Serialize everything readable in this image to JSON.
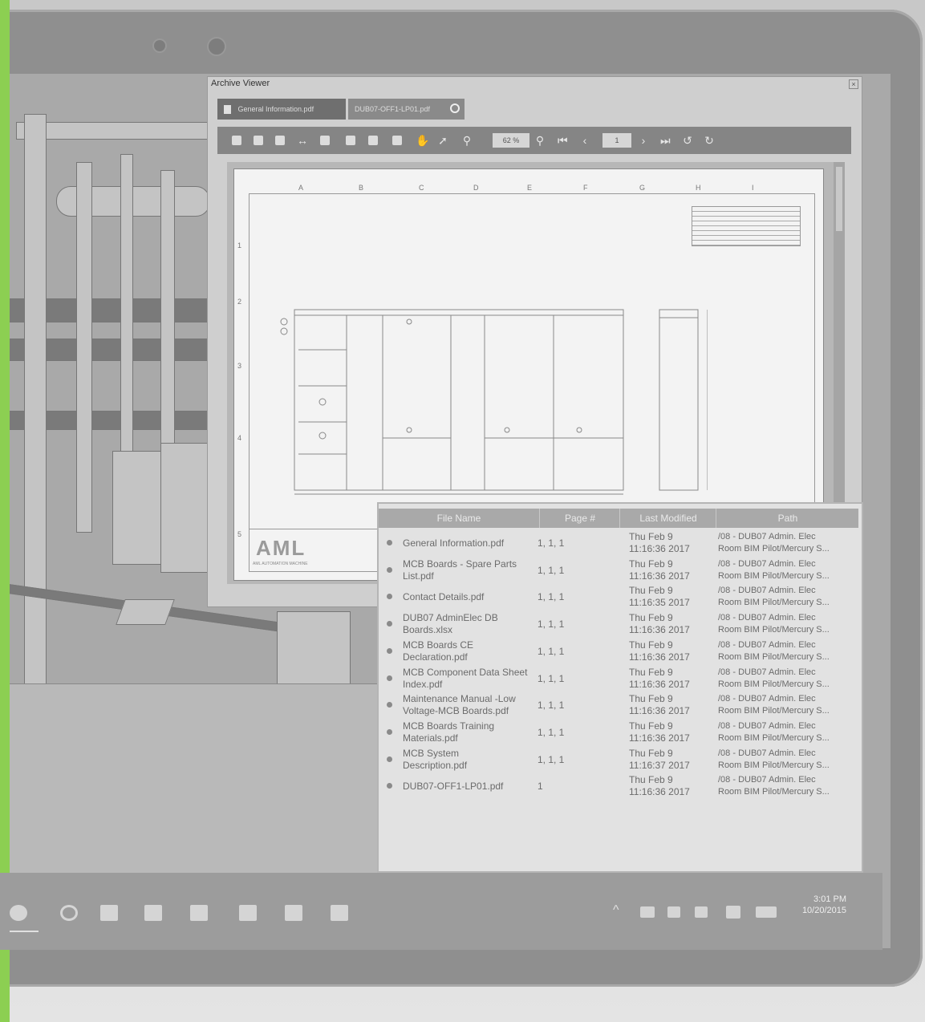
{
  "viewer": {
    "title": "Archive Viewer",
    "close_glyph": "×",
    "tabs": [
      {
        "label": "General Information.pdf",
        "icon": "pdf-doc-icon"
      },
      {
        "label": "DUB07-OFF1-LP01.pdf",
        "closable": true
      }
    ],
    "toolbar": {
      "zoom": "62 %",
      "page": "1"
    },
    "drawing": {
      "column_labels": [
        "A",
        "B",
        "C",
        "D",
        "E",
        "F",
        "G",
        "H",
        "I"
      ],
      "row_labels": [
        "1",
        "2",
        "3",
        "4",
        "5"
      ],
      "logo": "AML",
      "company": "AML AUTOMATION MACHINE"
    }
  },
  "file_list": {
    "headers": [
      "File Name",
      "Page #",
      "Last Modified",
      "Path"
    ],
    "rows": [
      {
        "name": "General Information.pdf",
        "pages": "1, 1, 1",
        "modified": [
          "Thu Feb 9",
          "11:16:36 2017"
        ],
        "path": [
          "/08 - DUB07 Admin. Elec",
          "Room BIM Pilot/Mercury S..."
        ]
      },
      {
        "name": "MCB Boards - Spare Parts List.pdf",
        "pages": "1, 1, 1",
        "modified": [
          "Thu Feb 9",
          "11:16:36 2017"
        ],
        "path": [
          "/08 - DUB07 Admin. Elec",
          "Room BIM Pilot/Mercury S..."
        ]
      },
      {
        "name": "Contact Details.pdf",
        "pages": "1, 1, 1",
        "modified": [
          "Thu Feb 9",
          "11:16:35 2017"
        ],
        "path": [
          "/08 - DUB07 Admin. Elec",
          "Room BIM Pilot/Mercury S..."
        ]
      },
      {
        "name": "DUB07 AdminElec DB Boards.xlsx",
        "pages": "1, 1, 1",
        "modified": [
          "Thu Feb 9",
          "11:16:36 2017"
        ],
        "path": [
          "/08 - DUB07 Admin. Elec",
          "Room BIM Pilot/Mercury S..."
        ]
      },
      {
        "name": "MCB Boards CE Declaration.pdf",
        "pages": "1, 1, 1",
        "modified": [
          "Thu Feb 9",
          "11:16:36 2017"
        ],
        "path": [
          "/08 - DUB07 Admin. Elec",
          "Room BIM Pilot/Mercury S..."
        ]
      },
      {
        "name": "MCB Component Data Sheet Index.pdf",
        "pages": "1, 1, 1",
        "modified": [
          "Thu Feb 9",
          "11:16:36 2017"
        ],
        "path": [
          "/08 - DUB07 Admin. Elec",
          "Room BIM Pilot/Mercury S..."
        ]
      },
      {
        "name": "Maintenance Manual -Low Voltage-MCB Boards.pdf",
        "pages": "1, 1, 1",
        "modified": [
          "Thu Feb 9",
          "11:16:36 2017"
        ],
        "path": [
          "/08 - DUB07 Admin. Elec",
          "Room BIM Pilot/Mercury S..."
        ]
      },
      {
        "name": "MCB Boards Training Materials.pdf",
        "pages": "1, 1, 1",
        "modified": [
          "Thu Feb 9",
          "11:16:36 2017"
        ],
        "path": [
          "/08 - DUB07 Admin. Elec",
          "Room BIM Pilot/Mercury S..."
        ]
      },
      {
        "name": "MCB System Description.pdf",
        "pages": "1, 1, 1",
        "modified": [
          "Thu Feb 9",
          "11:16:37 2017"
        ],
        "path": [
          "/08 - DUB07 Admin. Elec",
          "Room BIM Pilot/Mercury S..."
        ]
      },
      {
        "name": "DUB07-OFF1-LP01.pdf",
        "pages": "1",
        "modified": [
          "Thu Feb 9",
          "11:16:36 2017"
        ],
        "path": [
          "/08 - DUB07 Admin. Elec",
          "Room BIM Pilot/Mercury S..."
        ]
      }
    ]
  },
  "taskbar": {
    "time": "3:01 PM",
    "date": "10/20/2015"
  },
  "colors": {
    "accent_green": "#8ccf52"
  }
}
